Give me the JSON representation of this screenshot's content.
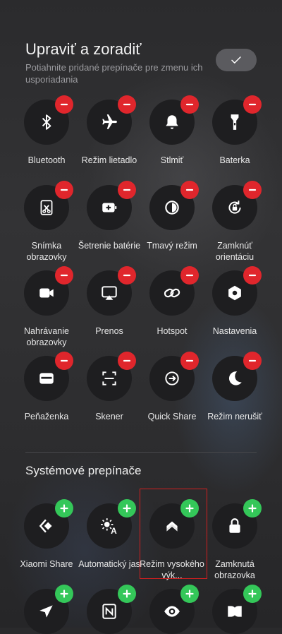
{
  "header": {
    "title": "Upraviť a zoradiť",
    "subtitle": "Potiahnite pridané prepínače pre zmenu ich usporiadania"
  },
  "added_toggles": [
    {
      "label": "Bluetooth",
      "icon": "bluetooth-icon"
    },
    {
      "label": "Režim lietadlo",
      "icon": "airplane-icon"
    },
    {
      "label": "Stlmiť",
      "icon": "bell-icon"
    },
    {
      "label": "Baterka",
      "icon": "flashlight-icon"
    },
    {
      "label": "Snímka obrazovky",
      "icon": "screenshot-icon"
    },
    {
      "label": "Šetrenie batérie",
      "icon": "battery-saver-icon"
    },
    {
      "label": "Tmavý režim",
      "icon": "dark-mode-icon"
    },
    {
      "label": "Zamknúť orientáciu",
      "icon": "rotation-lock-icon"
    },
    {
      "label": "Nahrávanie obrazovky",
      "icon": "screen-record-icon"
    },
    {
      "label": "Prenos",
      "icon": "cast-icon"
    },
    {
      "label": "Hotspot",
      "icon": "hotspot-icon"
    },
    {
      "label": "Nastavenia",
      "icon": "settings-icon"
    },
    {
      "label": "Peňaženka",
      "icon": "wallet-icon"
    },
    {
      "label": "Skener",
      "icon": "scanner-icon"
    },
    {
      "label": "Quick Share",
      "icon": "quick-share-icon"
    },
    {
      "label": "Režim nerušiť",
      "icon": "moon-icon"
    }
  ],
  "system_section": {
    "title": "Systémové prepínače",
    "toggles": [
      {
        "label": "Xiaomi Share",
        "icon": "xiaomi-share-icon"
      },
      {
        "label": "Automatický jas",
        "icon": "auto-brightness-icon"
      },
      {
        "label": "Režim vysokého výk...",
        "icon": "high-performance-icon"
      },
      {
        "label": "Zamknutá obrazovka",
        "icon": "lock-icon"
      },
      {
        "label": "",
        "icon": "location-icon"
      },
      {
        "label": "",
        "icon": "nfc-icon"
      },
      {
        "label": "",
        "icon": "eye-icon"
      },
      {
        "label": "",
        "icon": "dolby-icon"
      }
    ]
  },
  "colors": {
    "remove_badge": "#e0262c",
    "add_badge": "#34c759",
    "highlight": "#d21f1f"
  }
}
